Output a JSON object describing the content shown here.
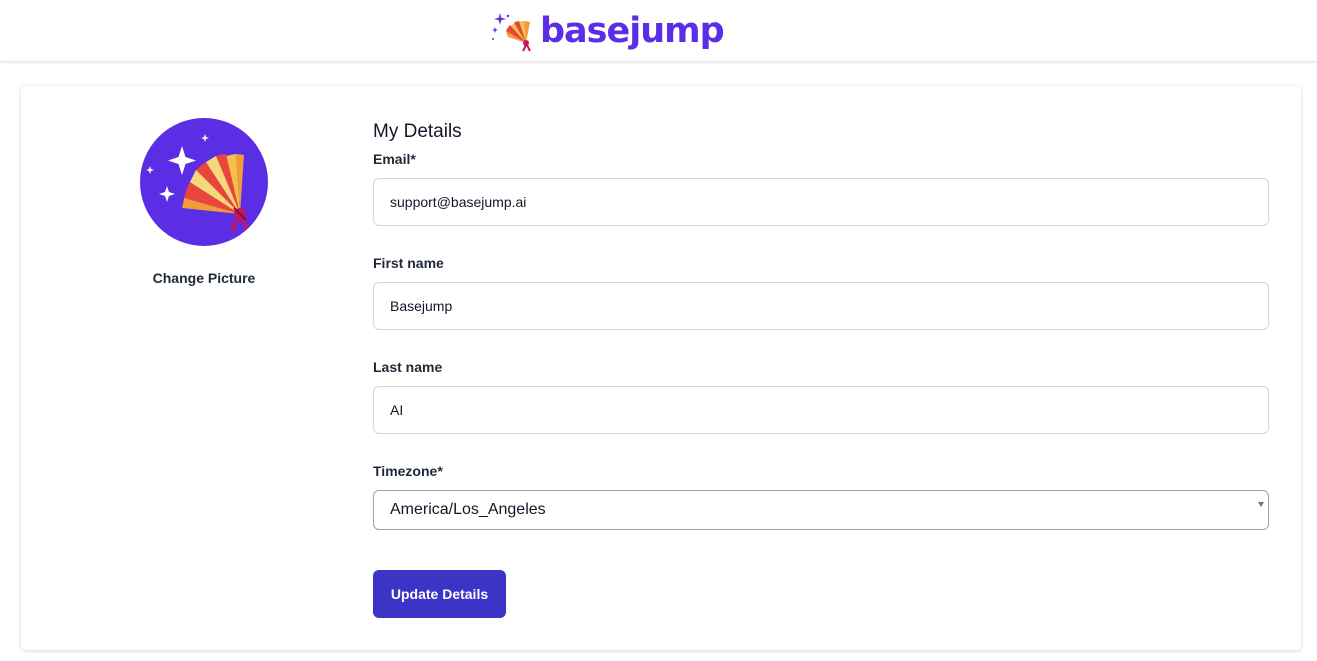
{
  "header": {
    "logo_text": "basejump",
    "logo_icon": "folding-fan-sparkles-icon"
  },
  "profile": {
    "avatar_icon": "folding-fan-sparkles-icon",
    "change_picture_label": "Change Picture"
  },
  "form": {
    "title": "My Details",
    "email": {
      "label": "Email*",
      "value": "support@basejump.ai"
    },
    "first_name": {
      "label": "First name",
      "value": "Basejump"
    },
    "last_name": {
      "label": "Last name",
      "value": "AI"
    },
    "timezone": {
      "label": "Timezone*",
      "selected": "America/Los_Angeles"
    },
    "submit_label": "Update Details"
  },
  "colors": {
    "brand": "#5b2ee6",
    "button": "#3b34c7"
  }
}
